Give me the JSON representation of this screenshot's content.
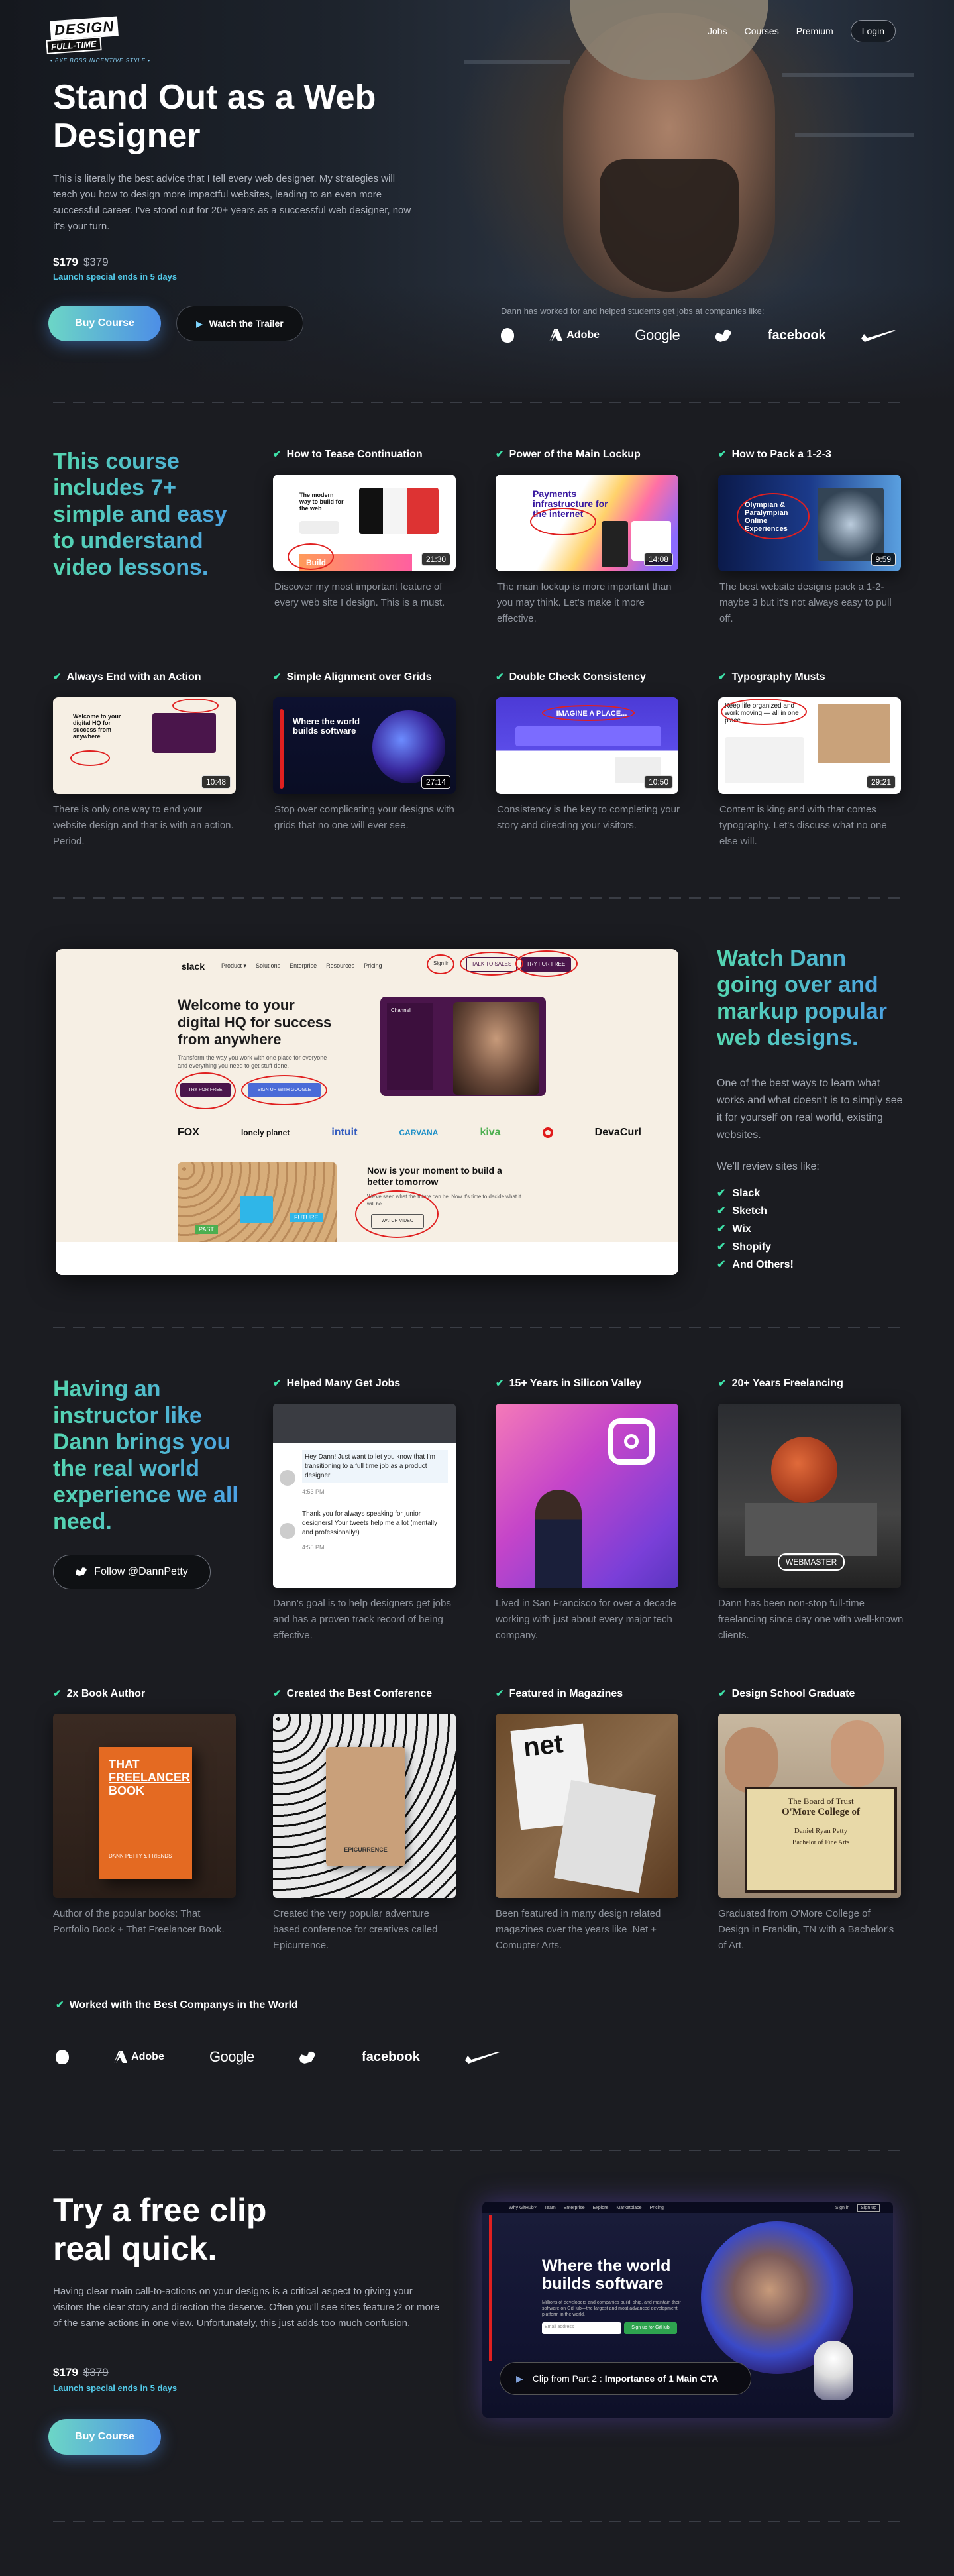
{
  "header": {
    "logo_line1": "DESIGN",
    "logo_line2": "FULL-TIME",
    "logo_tagline": "• BYE BOSS INCENTIVE STYLE •",
    "nav": [
      "Jobs",
      "Courses",
      "Premium"
    ],
    "login": "Login"
  },
  "hero": {
    "title": "Stand Out as a Web Designer",
    "lead": "This is literally the best advice that I tell every web designer. My strategies will teach you how to design more impactful websites, leading to an even more successful career. I've stood out for 20+ years as a successful web designer, now it's your turn.",
    "price": "$179",
    "old_price": "$379",
    "special": "Launch special ends in 5 days",
    "buy_label": "Buy Course",
    "trailer_label": "Watch the Trailer",
    "worked_text": "Dann has worked for and helped students get jobs at companies like:",
    "brands": [
      "apple-icon",
      "Adobe",
      "Google",
      "twitter-icon",
      "facebook",
      "nike-icon"
    ]
  },
  "lessons": {
    "heading": "This course includes 7+ simple and easy to understand video lessons.",
    "items": [
      {
        "title": "How to Tease Continuation",
        "desc": "Discover my most important feature of every web site I design. This is a must.",
        "duration": "21:30",
        "thumb_text": "The modern way to build for the web",
        "thumb_tag": "Build"
      },
      {
        "title": "Power of the Main Lockup",
        "desc": "The main lockup is more important than you may think. Let's make it more effective.",
        "duration": "14:08",
        "thumb_text": "Payments infrastructure for the internet"
      },
      {
        "title": "How to Pack a 1-2-3",
        "desc": "The best website designs pack a 1-2-maybe 3 but it's not always easy to pull off.",
        "duration": "9:59",
        "thumb_text": "Olympian & Paralympian Online Experiences"
      },
      {
        "title": "Always End with an Action",
        "desc": "There is only one way to end your website design and that is with an action. Period.",
        "duration": "10:48",
        "thumb_text": "Welcome to your digital HQ for success from anywhere"
      },
      {
        "title": "Simple Alignment over Grids",
        "desc": "Stop over complicating your designs with grids that no one will ever see.",
        "duration": "27:14",
        "thumb_text": "Where the world builds software"
      },
      {
        "title": "Double Check Consistency",
        "desc": "Consistency is the key to completing your story and directing your visitors.",
        "duration": "10:50",
        "thumb_text": "IMAGINE A PLACE..."
      },
      {
        "title": "Typography Musts",
        "desc": "Content is king and with that comes typography. Let's discuss what no one else will.",
        "duration": "29:21",
        "thumb_text": "Keep life organized and work moving — all in one place"
      }
    ]
  },
  "review": {
    "heading": "Watch Dann going over and markup popular web designs.",
    "text": "One of the best ways to learn what works and what doesn't is to simply see it for yourself on real world, existing websites.",
    "label": "We'll review sites like:",
    "sites": [
      "Slack",
      "Sketch",
      "Wix",
      "Shopify",
      "And Others!"
    ],
    "demo": {
      "brand": "slack",
      "menu": [
        "Product ▾",
        "Solutions",
        "Enterprise",
        "Resources",
        "Pricing"
      ],
      "signin": "Sign in",
      "talk": "TALK TO SALES",
      "try": "TRY FOR FREE",
      "headline": "Welcome to your digital HQ for success from anywhere",
      "sub": "Transform the way you work with one place for everyone and everything you need to get stuff done.",
      "btn1": "TRY FOR FREE",
      "btn2": "SIGN UP WITH GOOGLE",
      "logos": [
        "FOX",
        "lonely planet",
        "intuit",
        "CARVANA",
        "kiva",
        "target-icon",
        "DevaCurl"
      ],
      "moment_title": "Now is your moment to build a better tomorrow",
      "moment_text": "We've seen what the future can be. Now it's time to decide what it will be.",
      "watch": "WATCH VIDEO",
      "channel": "Channel",
      "past": "PAST",
      "future": "FUTURE"
    }
  },
  "instructor": {
    "heading": "Having an instructor like Dann brings you the real world experience we all need.",
    "follow": "Follow @DannPetty",
    "items": [
      {
        "title": "Helped Many Get Jobs",
        "desc": "Dann's goal is to help designers get jobs and has a proven track record of being effective.",
        "msg1": "Hey Dann! Just want to let you know that I'm transitioning to a full time job as a product designer",
        "msg2": "Thank you for always speaking for junior designers! Your tweets help me a lot (mentally and professionally!)",
        "time1": "4:53 PM",
        "time2": "4:55 PM"
      },
      {
        "title": "15+ Years in Silicon Valley",
        "desc": "Lived in San Francisco for over a decade working with just about every major tech company."
      },
      {
        "title": "20+ Years Freelancing",
        "desc": "Dann has been non-stop full-time freelancing since day one with well-known clients.",
        "sign": "WEBMASTER"
      },
      {
        "title": "2x Book Author",
        "desc": "Author of the popular books: That Portfolio Book + That Freelancer Book.",
        "book1": "THAT",
        "book2": "FREELANCER",
        "book3": "BOOK",
        "book4": "DANN PETTY & FRIENDS"
      },
      {
        "title": "Created the Best Conference",
        "desc": "Created the very popular adventure based conference for creatives called Epicurrence.",
        "badge": "EPICURRENCE"
      },
      {
        "title": "Featured in Magazines",
        "desc": "Been featured in many design related magazines over the years like .Net + Comupter Arts.",
        "mag": "net"
      },
      {
        "title": "Design School Graduate",
        "desc": "Graduated from O'More College of Design in Franklin, TN with a Bachelor's of Art.",
        "dip1": "The Board of Trust",
        "dip2": "O'More College of",
        "dip3": "Daniel Ryan Petty",
        "dip4": "Bachelor of Fine Arts"
      }
    ],
    "companies_title": "Worked with the Best Companys in the World",
    "companies": [
      "apple-icon",
      "Adobe",
      "Google",
      "twitter-icon",
      "facebook",
      "nike-icon"
    ]
  },
  "cta": {
    "title": "Try a free clip real quick.",
    "text": "Having clear main call-to-actions on your designs is a critical aspect to giving your visitors the clear story and direction the deserve. Often you'll see sites feature 2 or more of the same actions in one view. Unfortunately, this just adds too much confusion.",
    "price": "$179",
    "old_price": "$379",
    "special": "Launch special ends in 5 days",
    "buy_label": "Buy Course",
    "clip_headline": "Where the world builds software",
    "clip_label": "Clip from Part 2 :",
    "clip_title": "Importance of 1 Main CTA",
    "clip_nav": [
      "Why GitHub?",
      "Team",
      "Enterprise",
      "Explore",
      "Marketplace",
      "Pricing"
    ],
    "clip_signin": "Sign in",
    "clip_signup": "Sign up",
    "clip_email": "Email address",
    "clip_btn": "Sign up for GitHub",
    "clip_sub": "Millions of developers and companies build, ship, and maintain their software on GitHub—the largest and most advanced development platform in the world."
  },
  "colors": {
    "accent_green": "#3ee0a8",
    "accent_blue": "#4a9ce8",
    "special": "#52c9e8",
    "bg": "#1b1c21"
  }
}
